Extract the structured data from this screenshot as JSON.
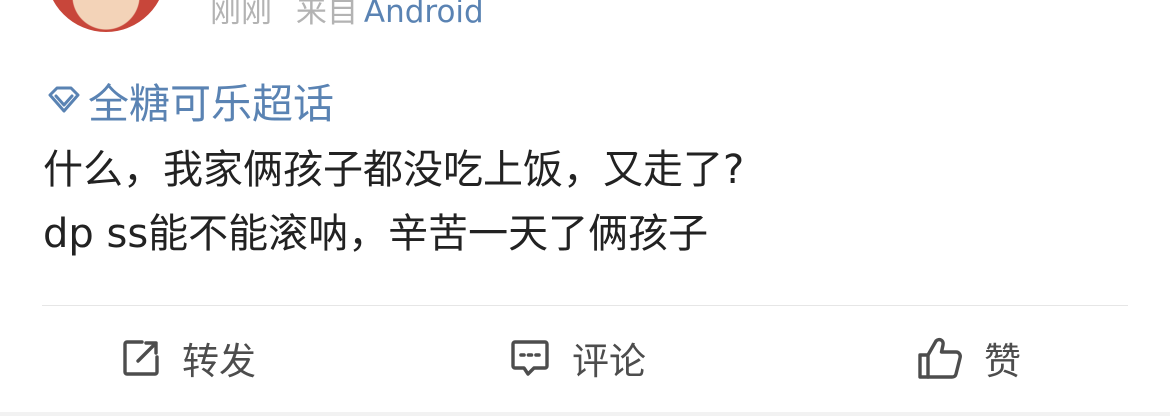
{
  "post": {
    "time": "刚刚",
    "source_prefix": "来自",
    "source": "Android",
    "topic": {
      "label": "全糖可乐超话",
      "icon": "diamond-icon"
    },
    "content_lines": [
      "什么，我家俩孩子都没吃上饭，又走了?",
      "dp ss能不能滚呐，辛苦一天了俩孩子"
    ]
  },
  "actions": {
    "repost": {
      "label": "转发",
      "icon": "share-icon"
    },
    "comment": {
      "label": "评论",
      "icon": "comment-icon"
    },
    "like": {
      "label": "赞",
      "icon": "thumbs-up-icon"
    }
  },
  "colors": {
    "link": "#5a83b3",
    "text": "#222222",
    "meta": "#b3b3b3",
    "action": "#4d4d4d"
  }
}
